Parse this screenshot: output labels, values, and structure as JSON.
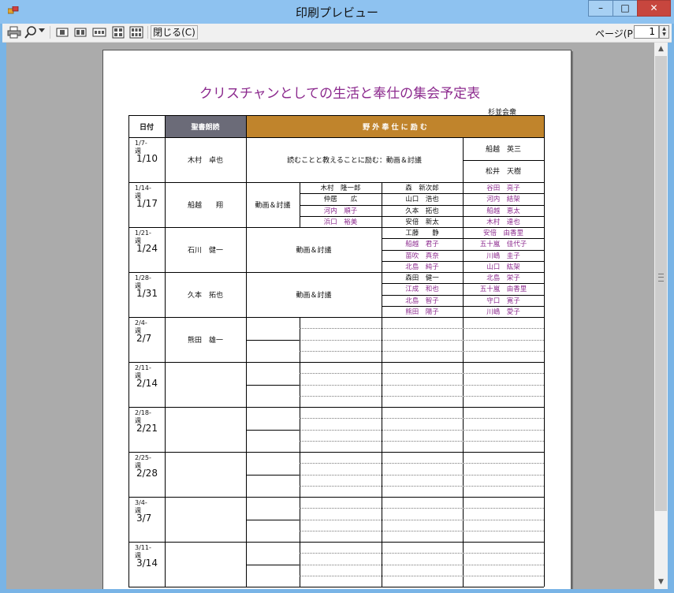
{
  "window": {
    "title": "印刷プレビュー",
    "min": "–",
    "max": "□",
    "close": "✕"
  },
  "toolbar": {
    "icons": [
      "print-icon",
      "zoom-icon",
      "dropdown-arrow-icon",
      "one-page-icon",
      "two-pages-icon",
      "three-pages-icon",
      "four-pages-icon",
      "six-pages-icon"
    ],
    "close_label": "閉じる(C)",
    "page_label": "ページ(P)",
    "page_value": "1"
  },
  "document": {
    "title": "クリスチャンとしての生活と奉仕の集会予定表",
    "subtitle": "杉並会衆",
    "headers": {
      "date": "日付",
      "reading": "聖書朗読",
      "ministry": "野 外 奉 仕 に 励 む"
    },
    "weeks": [
      {
        "week": "1/7-週",
        "date": "1/10",
        "reader": "木村　卓也",
        "program": "読むことと教えることに励む：動画＆討議",
        "right": [
          "船越　英三",
          "松井　天樹"
        ]
      },
      {
        "week": "1/14-週",
        "date": "1/17",
        "reader": "船越　　翔",
        "program": "動画＆討議",
        "pairs": [
          [
            "木村　隆一郎",
            "森　新次郎",
            "谷田　亮子"
          ],
          [
            "仲居　　広",
            "山口　浩也",
            "河内　結架"
          ],
          [
            "河内　順子",
            "久本　拓也",
            "船越　恵太"
          ],
          [
            "浜口　裕美",
            "安倍　新太",
            "木村　達也"
          ]
        ]
      },
      {
        "week": "1/21-週",
        "date": "1/24",
        "reader": "石川　健一",
        "program": "動画＆討議",
        "pairs": [
          [
            "工藤　　静",
            "安倍　由香里"
          ],
          [
            "船越　君子",
            "五十嵐　佳代子"
          ],
          [
            "苗吹　真奈",
            "川嶋　圭子"
          ],
          [
            "北島　純子",
            "山口　紘架"
          ]
        ]
      },
      {
        "week": "1/28-週",
        "date": "1/31",
        "reader": "久本　拓也",
        "program": "動画＆討議",
        "pairs": [
          [
            "森田　健一",
            "北島　栄子"
          ],
          [
            "江成　和也",
            "五十嵐　由香里"
          ],
          [
            "北島　智子",
            "守口　寛子"
          ],
          [
            "熊田　陽子",
            "川嶋　愛子"
          ]
        ]
      },
      {
        "week": "2/4-週",
        "date": "2/7",
        "reader": "熊田　雄一"
      },
      {
        "week": "2/11-週",
        "date": "2/14",
        "reader": ""
      },
      {
        "week": "2/18-週",
        "date": "2/21",
        "reader": ""
      },
      {
        "week": "2/25-週",
        "date": "2/28",
        "reader": ""
      },
      {
        "week": "3/4-週",
        "date": "3/7",
        "reader": ""
      },
      {
        "week": "3/11-週",
        "date": "3/14",
        "reader": ""
      }
    ]
  },
  "colors": {
    "header_gray": "#6b6b78",
    "header_gold": "#c0842c",
    "title_purple": "#8c2a8e",
    "names_purple": "#8c2a8e"
  }
}
